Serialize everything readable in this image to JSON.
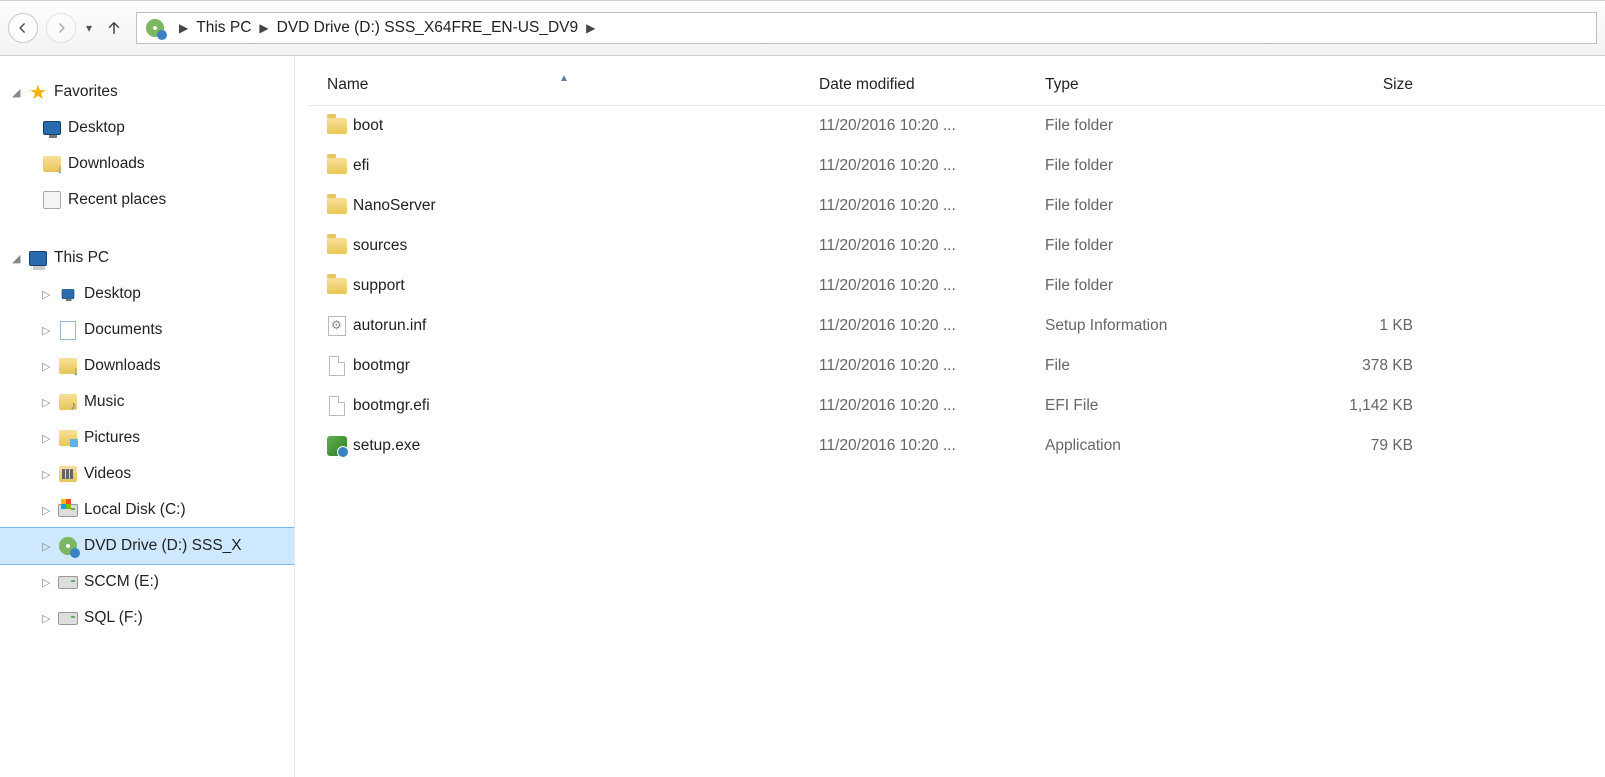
{
  "breadcrumb": {
    "seg0": "This PC",
    "seg1": "DVD Drive (D:) SSS_X64FRE_EN-US_DV9"
  },
  "columns": {
    "name": "Name",
    "date": "Date modified",
    "type": "Type",
    "size": "Size"
  },
  "sidebar": {
    "favorites": "Favorites",
    "desktop": "Desktop",
    "downloads": "Downloads",
    "recent": "Recent places",
    "thispc": "This PC",
    "pc_desktop": "Desktop",
    "pc_documents": "Documents",
    "pc_downloads": "Downloads",
    "pc_music": "Music",
    "pc_pictures": "Pictures",
    "pc_videos": "Videos",
    "pc_cdrive": "Local Disk (C:)",
    "pc_dvd": "DVD Drive (D:) SSS_X",
    "pc_sccm": "SCCM (E:)",
    "pc_sql": "SQL (F:)"
  },
  "files": [
    {
      "icon": "folder",
      "name": "boot",
      "date": "11/20/2016 10:20 ...",
      "type": "File folder",
      "size": ""
    },
    {
      "icon": "folder",
      "name": "efi",
      "date": "11/20/2016 10:20 ...",
      "type": "File folder",
      "size": ""
    },
    {
      "icon": "folder",
      "name": "NanoServer",
      "date": "11/20/2016 10:20 ...",
      "type": "File folder",
      "size": ""
    },
    {
      "icon": "folder",
      "name": "sources",
      "date": "11/20/2016 10:20 ...",
      "type": "File folder",
      "size": ""
    },
    {
      "icon": "folder",
      "name": "support",
      "date": "11/20/2016 10:20 ...",
      "type": "File folder",
      "size": ""
    },
    {
      "icon": "inf",
      "name": "autorun.inf",
      "date": "11/20/2016 10:20 ...",
      "type": "Setup Information",
      "size": "1 KB"
    },
    {
      "icon": "file",
      "name": "bootmgr",
      "date": "11/20/2016 10:20 ...",
      "type": "File",
      "size": "378 KB"
    },
    {
      "icon": "file",
      "name": "bootmgr.efi",
      "date": "11/20/2016 10:20 ...",
      "type": "EFI File",
      "size": "1,142 KB"
    },
    {
      "icon": "exe",
      "name": "setup.exe",
      "date": "11/20/2016 10:20 ...",
      "type": "Application",
      "size": "79 KB"
    }
  ]
}
